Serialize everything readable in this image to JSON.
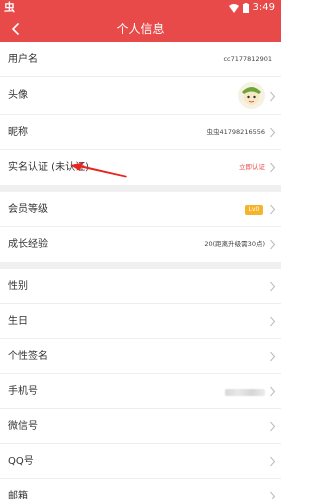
{
  "status_bar": {
    "left_glyph": "虫",
    "time": "3:49",
    "icons": [
      "wifi-icon",
      "battery-icon"
    ]
  },
  "header": {
    "title": "个人信息",
    "back_icon": "back-arrow-icon"
  },
  "colors": {
    "accent": "#e84a4a",
    "level_badge": "#f5b42a",
    "divider": "#f0f0f0"
  },
  "rows": {
    "username": {
      "label": "用户名",
      "value": "cc7177812901"
    },
    "avatar": {
      "label": "头像"
    },
    "nickname": {
      "label": "昵称",
      "value": "虫虫41798216556"
    },
    "realname": {
      "label": "实名认证 (未认证)",
      "value": "立即认证"
    },
    "level": {
      "label": "会员等级",
      "badge": "Lv0"
    },
    "growth": {
      "label": "成长经验",
      "value": "20(距离升级需30点)"
    },
    "gender": {
      "label": "性别"
    },
    "birthday": {
      "label": "生日"
    },
    "signature": {
      "label": "个性签名"
    },
    "phone": {
      "label": "手机号"
    },
    "wechat": {
      "label": "微信号"
    },
    "qq": {
      "label": "QQ号"
    },
    "email": {
      "label": "邮箱"
    }
  }
}
